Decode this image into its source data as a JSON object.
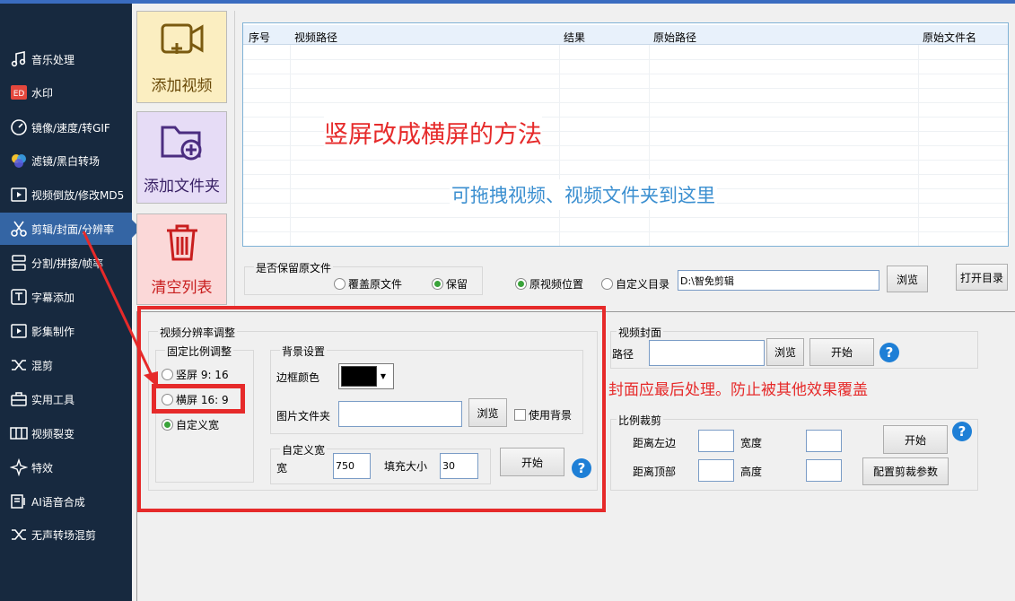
{
  "sidebar": {
    "items": [
      {
        "label": "音乐处理",
        "icon": "music-note-icon"
      },
      {
        "label": "水印",
        "icon": "watermark-icon"
      },
      {
        "label": "镜像/速度/转GIF",
        "icon": "speed-gauge-icon"
      },
      {
        "label": "滤镜/黑白转场",
        "icon": "filter-circles-icon"
      },
      {
        "label": "视频倒放/修改MD5",
        "icon": "reverse-play-icon"
      },
      {
        "label": "剪辑/封面/分辨率",
        "icon": "scissors-icon"
      },
      {
        "label": "分割/拼接/帧率",
        "icon": "split-icon"
      },
      {
        "label": "字幕添加",
        "icon": "subtitle-icon"
      },
      {
        "label": "影集制作",
        "icon": "album-icon"
      },
      {
        "label": "混剪",
        "icon": "shuffle-icon"
      },
      {
        "label": "实用工具",
        "icon": "toolbox-icon"
      },
      {
        "label": "视频裂变",
        "icon": "fission-icon"
      },
      {
        "label": "特效",
        "icon": "sparkle-icon"
      },
      {
        "label": "AI语音合成",
        "icon": "ai-voice-icon"
      },
      {
        "label": "无声转场混剪",
        "icon": "shuffle-icon"
      }
    ],
    "active_index": 5
  },
  "actions": {
    "add_video": "添加视频",
    "add_folder": "添加文件夹",
    "clear_list": "清空列表"
  },
  "table": {
    "columns": [
      "序号",
      "视频路径",
      "结果",
      "原始路径",
      "原始文件名"
    ],
    "overlay_title": "竖屏改成横屏的方法",
    "drop_hint": "可拖拽视频、视频文件夹到这里"
  },
  "keep_original": {
    "title": "是否保留原文件",
    "options": [
      "覆盖原文件",
      "保留"
    ],
    "selected": "保留"
  },
  "output": {
    "options": [
      "原视频位置",
      "自定义目录"
    ],
    "selected": "原视频位置",
    "path_value": "D:\\智免剪辑",
    "browse": "浏览",
    "open_dir": "打开目录"
  },
  "resolution": {
    "title": "视频分辨率调整",
    "fixed_title": "固定比例调整",
    "options": [
      "竖屏 9: 16",
      "横屏 16: 9",
      "自定义宽"
    ],
    "selected": "自定义宽",
    "bg_title": "背景设置",
    "border_color_label": "边框颜色",
    "border_color": "#000000",
    "image_folder_label": "图片文件夹",
    "browse": "浏览",
    "use_bg": "使用背景",
    "custom_title": "自定义宽",
    "width_label": "宽",
    "width_value": "750",
    "fill_label": "填充大小",
    "fill_value": "30",
    "start": "开始"
  },
  "cover": {
    "title": "视频封面",
    "path_label": "路径",
    "browse": "浏览",
    "start": "开始",
    "note": "封面应最后处理。防止被其他效果覆盖"
  },
  "crop": {
    "title": "比例裁剪",
    "left_label": "距离左边",
    "width_label": "宽度",
    "top_label": "距离顶部",
    "height_label": "高度",
    "start": "开始",
    "config": "配置剪裁参数"
  },
  "help_symbol": "?",
  "colors": {
    "sidebar_bg": "#17293f",
    "sidebar_active": "#3465a4",
    "annotation_red": "#e62a2a",
    "add_video_bg": "#fbeec1",
    "add_folder_bg": "#e6dcf6",
    "clear_bg": "#fbd8d8",
    "hint_blue": "#3b8fd0"
  }
}
